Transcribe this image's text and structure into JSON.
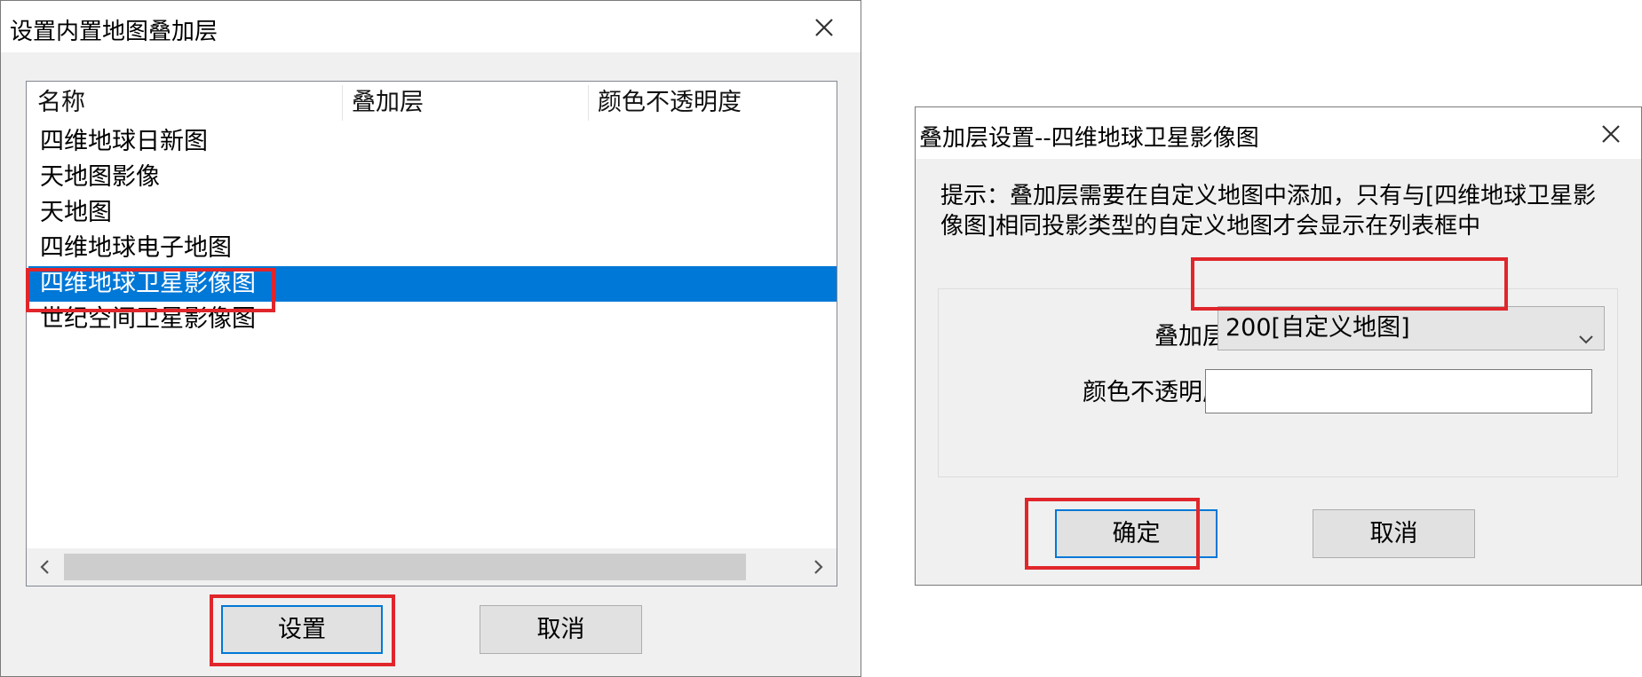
{
  "left_dialog": {
    "title": "设置内置地图叠加层",
    "columns": [
      "名称",
      "叠加层",
      "颜色不透明度"
    ],
    "rows": [
      "四维地球日新图",
      "天地图影像",
      "天地图",
      "四维地球电子地图",
      "四维地球卫星影像图",
      "世纪空间卫星影像图"
    ],
    "selected_row_index": 4,
    "set_button": "设置",
    "cancel_button": "取消"
  },
  "right_dialog": {
    "title": "叠加层设置--四维地球卫星影像图",
    "hint": "提示：叠加层需要在自定义地图中添加，只有与[四维地球卫星影像图]相同投影类型的自定义地图才会显示在列表框中",
    "overlay_label": "叠加层",
    "overlay_value": "200[自定义地图]",
    "opacity_label": "颜色不透明度",
    "opacity_value": "",
    "ok_button": "确定",
    "cancel_button": "取消"
  },
  "icons": {
    "close": "close-icon",
    "scroll_left": "chevron-left-icon",
    "scroll_right": "chevron-right-icon",
    "dropdown": "chevron-down-icon"
  },
  "colors": {
    "selection": "#0078d7",
    "highlight_box": "#e0262b",
    "dialog_bg": "#f0f0f0"
  }
}
